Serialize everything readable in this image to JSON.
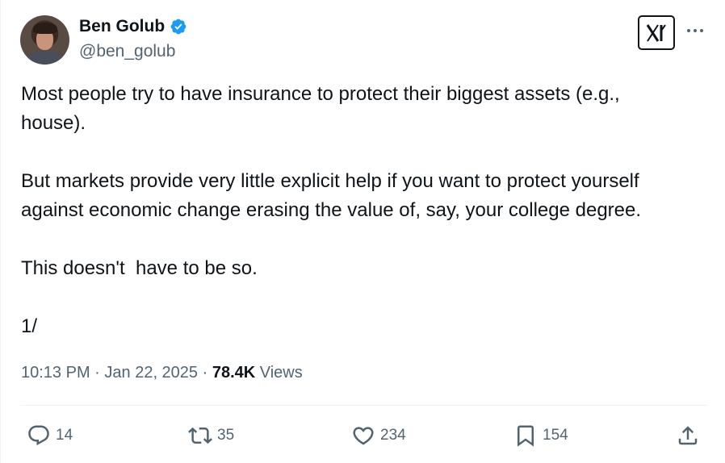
{
  "author": {
    "display_name": "Ben Golub",
    "handle": "@ben_golub",
    "verified": true
  },
  "tweet": {
    "paragraphs": [
      "Most people try to have insurance to protect their biggest assets (e.g.,\nhouse).",
      "But markets provide very little explicit help if you want to protect yourself\nagainst economic change erasing the value of, say, your college degree.",
      "This doesn't  have to be so.",
      "1/"
    ],
    "time": "10:13 PM",
    "separator": " · ",
    "date": "Jan 22, 2025",
    "views_count": "78.4K",
    "views_label": " Views"
  },
  "actions": {
    "replies": "14",
    "retweets": "35",
    "likes": "234",
    "bookmarks": "154"
  },
  "colors": {
    "text": "#0f1419",
    "secondary": "#536471",
    "verified_badge": "#1d9bf0",
    "divider": "#eff3f4"
  },
  "icons": [
    "verified-badge-icon",
    "x-logo-icon",
    "more-options-icon",
    "reply-icon",
    "retweet-icon",
    "like-icon",
    "bookmark-icon",
    "share-icon"
  ]
}
